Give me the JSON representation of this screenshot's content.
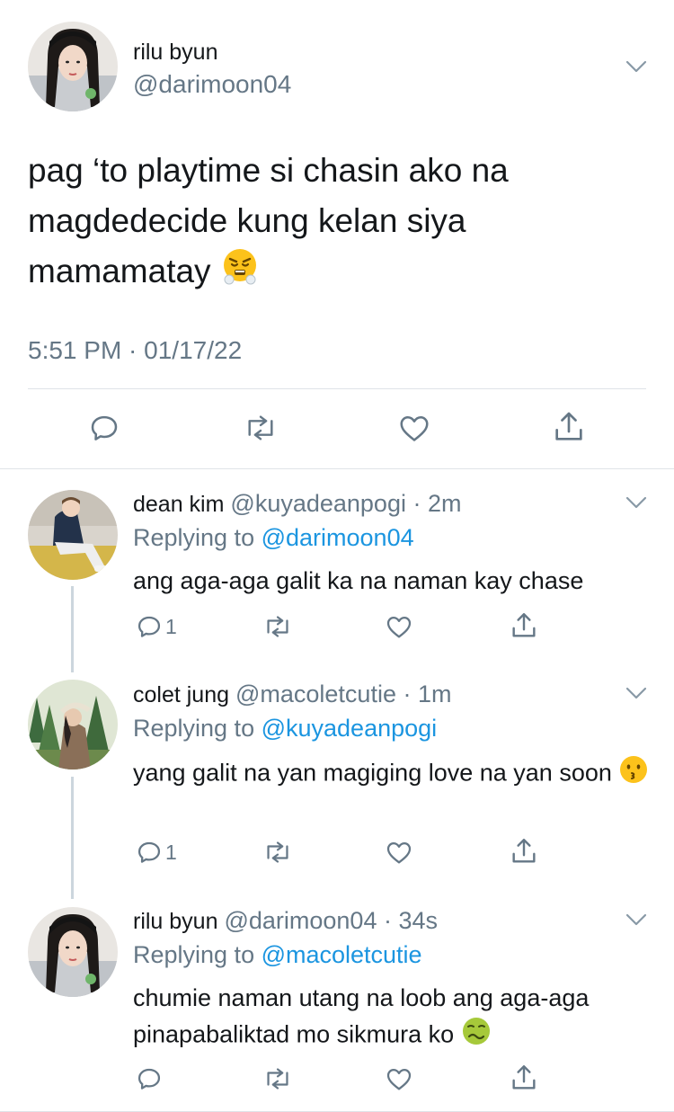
{
  "main_tweet": {
    "name": "rilu byun",
    "handle": "@darimoon04",
    "text": "pag ‘to playtime si chasin ako na magdedecide kung kelan siya mamamatay",
    "emoji": "face-with-steam-from-nose",
    "timestamp": "5:51 PM · 01/17/22"
  },
  "replies": [
    {
      "name": "dean kim",
      "handle": "@kuyadeanpogi",
      "time": "2m",
      "replying_prefix": "Replying to ",
      "replying_to": "@darimoon04",
      "text": "ang aga-aga galit ka na naman kay chase",
      "reply_count": "1"
    },
    {
      "name": "colet jung",
      "handle": "@macoletcutie",
      "time": "1m",
      "replying_prefix": "Replying to ",
      "replying_to": "@kuyadeanpogi",
      "text": "yang galit na yan magiging love na yan soon",
      "emoji": "kissing-face",
      "reply_count": "1"
    },
    {
      "name": "rilu byun",
      "handle": "@darimoon04",
      "time": "34s",
      "replying_prefix": "Replying to ",
      "replying_to": "@macoletcutie",
      "text": "chumie naman utang na loob ang aga-aga pinapabaliktad mo sikmura ko",
      "emoji": "nauseated-face",
      "reply_count": ""
    }
  ],
  "colors": {
    "text": "#14171a",
    "secondary": "#657786",
    "link": "#1b95e0",
    "divider": "#dfe3e8"
  }
}
